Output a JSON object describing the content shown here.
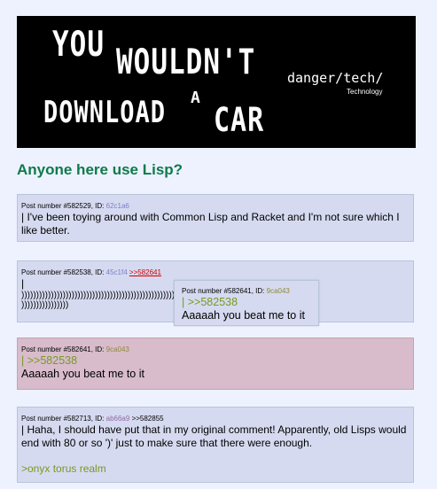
{
  "banner": {
    "line1": "YOU",
    "line2": "WOULDN'T",
    "line3": "DOWNLOAD",
    "line4": "A",
    "line5": "CAR",
    "site": "danger/tech/",
    "subtitle": "Technology"
  },
  "thread": {
    "title": "Anyone here use Lisp?"
  },
  "posts": [
    {
      "label": "Post number #582529, ID: ",
      "id": "62c1a6",
      "text": "| I've been toying around with Common Lisp and Racket and I'm not sure which I like better."
    },
    {
      "label": "Post number #582538, ID: ",
      "id": "45c1f4",
      "reply_link": ">>582641",
      "pipe": "|",
      "parens1": "))))))))))))))))))))))))))))))))))))))))))))))))))))))))))))))))))))))))))))))))))))))))))))))))))))",
      "parens2": "))))))))))))))))"
    },
    {
      "label": "Post number #582641, ID: ",
      "id": "9ca043",
      "pipe": "| ",
      "quote": ">>582538",
      "text": "Aaaaah you beat me to it"
    },
    {
      "label": "Post number #582713, ID: ",
      "id": "ab66a9",
      "reply_ref": ">>582855",
      "text": "| Haha, I should have put that in my original comment! Apparently, old Lisps would end with 80 or so ')' just to make sure that there were enough.",
      "greentext": ">onyx torus realm"
    }
  ],
  "preview": {
    "label": "Post number #582641, ID: ",
    "id": "9ca043",
    "pipe": "| ",
    "quote": ">>582538",
    "text": "Aaaaah you beat me to it"
  }
}
